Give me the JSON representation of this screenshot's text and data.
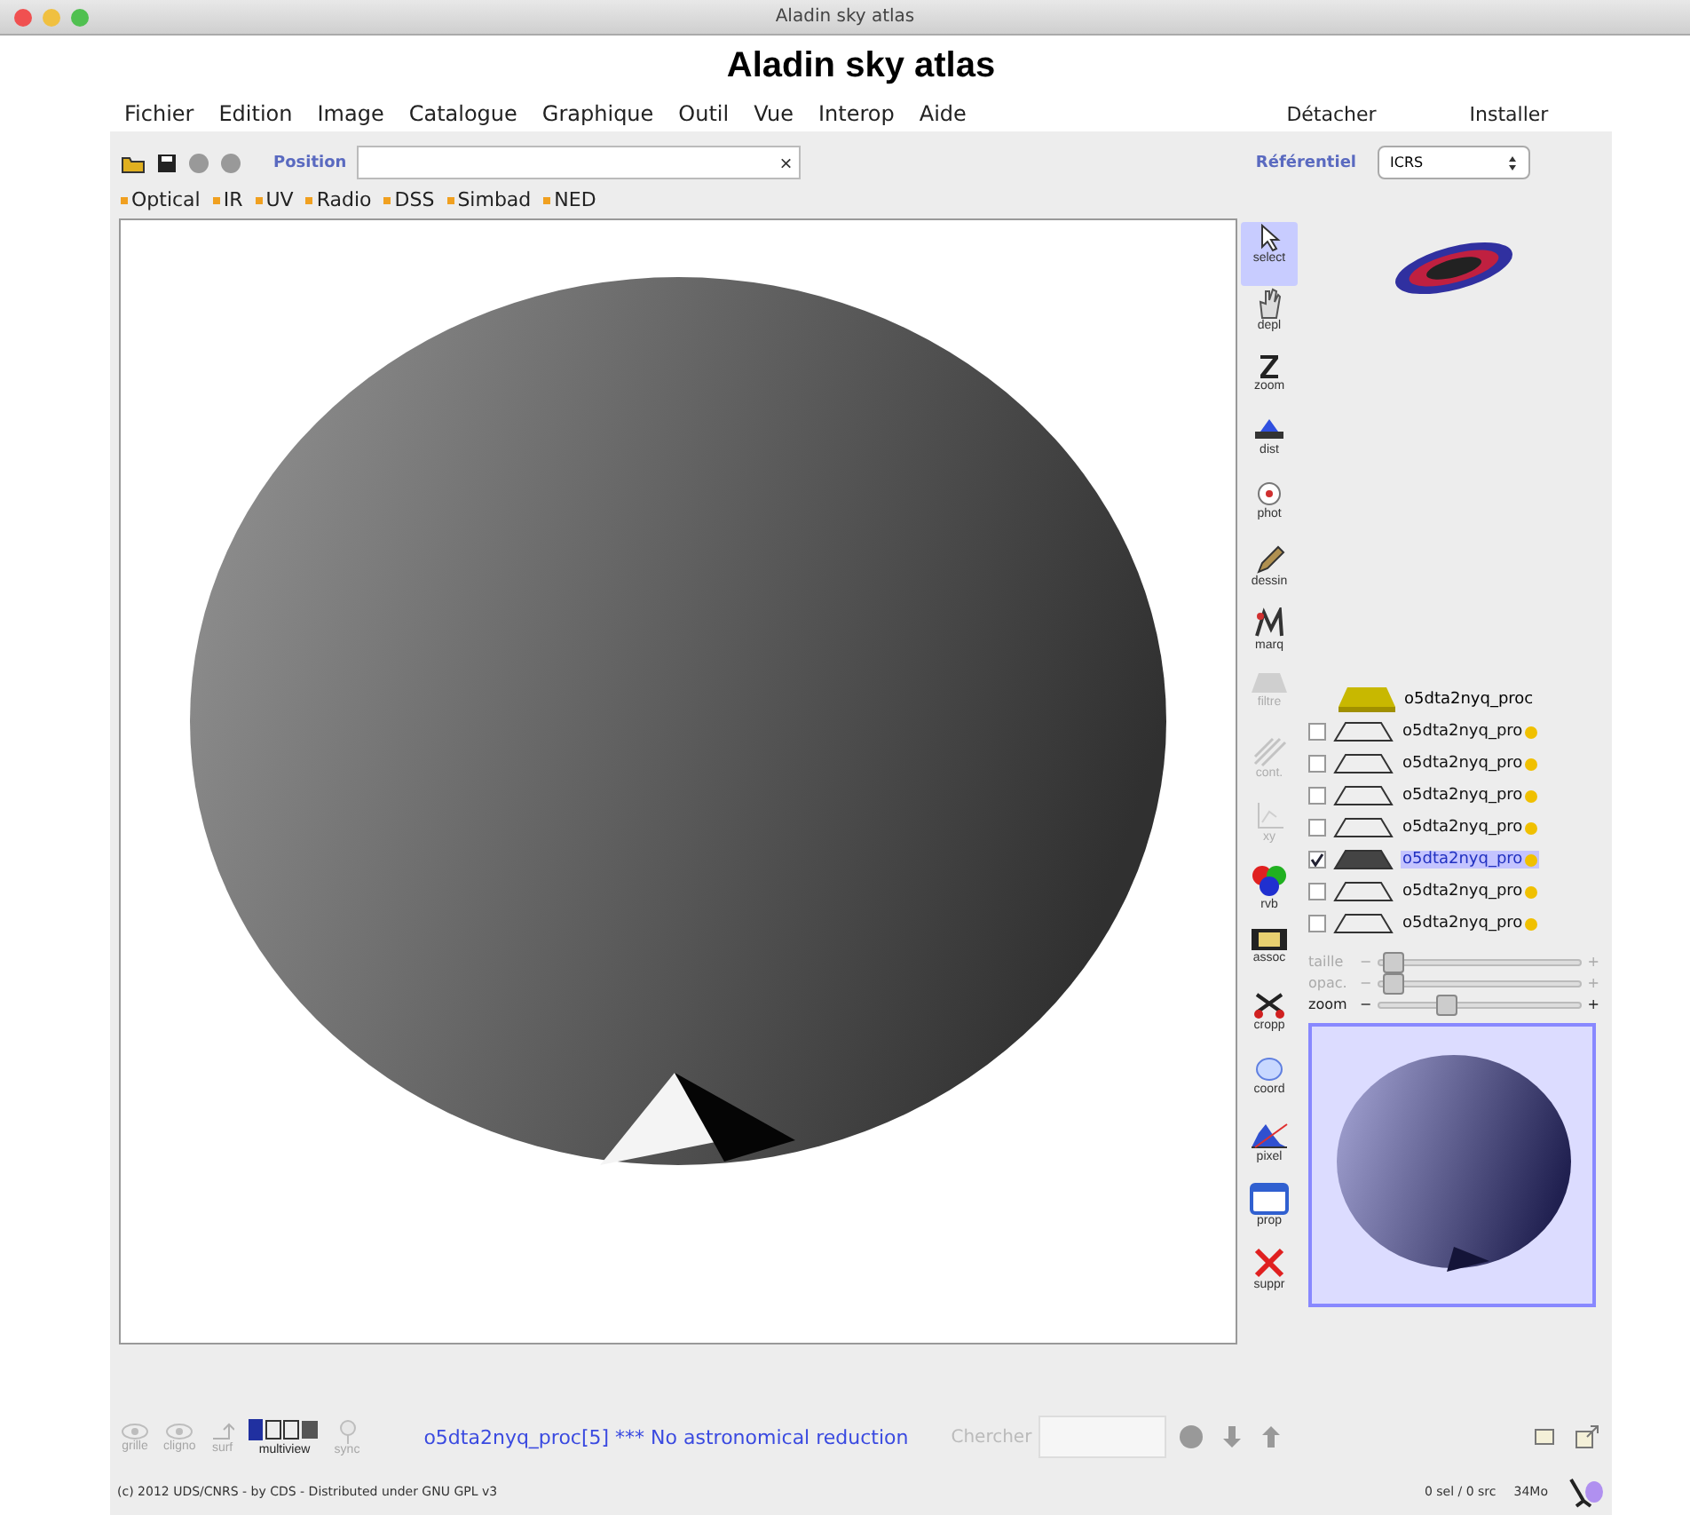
{
  "window": {
    "title": "Aladin sky atlas"
  },
  "app_title": "Aladin sky atlas",
  "menu": [
    "Fichier",
    "Edition",
    "Image",
    "Catalogue",
    "Graphique",
    "Outil",
    "Vue",
    "Interop",
    "Aide"
  ],
  "menu_right": [
    "Détacher",
    "Installer"
  ],
  "toolbar": {
    "position_label": "Position",
    "clear": "×",
    "frame_label": "Référentiel",
    "frame_value": "ICRS"
  },
  "servers": [
    "Optical",
    "IR",
    "UV",
    "Radio",
    "DSS",
    "Simbad",
    "NED"
  ],
  "tools": [
    {
      "kind": "select",
      "label": "select",
      "selected": true,
      "disabled": false
    },
    {
      "kind": "hand",
      "label": "depl",
      "selected": false,
      "disabled": false
    },
    {
      "kind": "zoom",
      "label": "zoom",
      "selected": false,
      "disabled": false
    },
    {
      "kind": "dist",
      "label": "dist",
      "selected": false,
      "disabled": false
    },
    {
      "kind": "phot",
      "label": "phot",
      "selected": false,
      "disabled": false
    },
    {
      "kind": "pencil",
      "label": "dessin",
      "selected": false,
      "disabled": false
    },
    {
      "kind": "marq",
      "label": "marq",
      "selected": false,
      "disabled": false
    },
    {
      "kind": "filter",
      "label": "filtre",
      "selected": false,
      "disabled": true
    },
    {
      "kind": "cont",
      "label": "cont.",
      "selected": false,
      "disabled": true
    },
    {
      "kind": "plot",
      "label": "xy",
      "selected": false,
      "disabled": true
    },
    {
      "kind": "rgb",
      "label": "rvb",
      "selected": false,
      "disabled": false
    },
    {
      "kind": "film",
      "label": "assoc",
      "selected": false,
      "disabled": false
    },
    {
      "kind": "scissors",
      "label": "cropp",
      "selected": false,
      "disabled": false
    },
    {
      "kind": "globe",
      "label": "coord",
      "selected": false,
      "disabled": false
    },
    {
      "kind": "hist",
      "label": "pixel",
      "selected": false,
      "disabled": false
    },
    {
      "kind": "window",
      "label": "prop",
      "selected": false,
      "disabled": false
    },
    {
      "kind": "delete",
      "label": "suppr",
      "selected": false,
      "disabled": false
    }
  ],
  "stack": {
    "folder": "o5dta2nyq_proc",
    "planes": [
      {
        "name": "o5dta2nyq_pro",
        "checked": false,
        "selected": false
      },
      {
        "name": "o5dta2nyq_pro",
        "checked": false,
        "selected": false
      },
      {
        "name": "o5dta2nyq_pro",
        "checked": false,
        "selected": false
      },
      {
        "name": "o5dta2nyq_pro",
        "checked": false,
        "selected": false
      },
      {
        "name": "o5dta2nyq_pro",
        "checked": true,
        "selected": true
      },
      {
        "name": "o5dta2nyq_pro",
        "checked": false,
        "selected": false
      },
      {
        "name": "o5dta2nyq_pro",
        "checked": false,
        "selected": false
      }
    ]
  },
  "sliders": [
    {
      "label": "taille",
      "minus": "−",
      "plus": "+",
      "level": 0.04,
      "disabled": true
    },
    {
      "label": "opac.",
      "minus": "−",
      "plus": "+",
      "level": 0.04,
      "disabled": true
    },
    {
      "label": "zoom",
      "minus": "−",
      "plus": "+",
      "level": 0.3,
      "disabled": false
    }
  ],
  "bottom_tools": [
    {
      "kind": "eye",
      "label": "grille",
      "disabled": true
    },
    {
      "kind": "eye",
      "label": "cligno",
      "disabled": true
    },
    {
      "kind": "arrow",
      "label": "surf",
      "disabled": true
    },
    {
      "kind": "grid",
      "label": "multiview",
      "disabled": false
    },
    {
      "kind": "pin",
      "label": "sync",
      "disabled": true
    }
  ],
  "status_message": "o5dta2nyq_proc[5] *** No astronomical reduction",
  "search_label": "Chercher",
  "footer": {
    "copyright": "(c) 2012 UDS/CNRS - by CDS - Distributed under GNU GPL v3",
    "selection": "0 sel / 0 src",
    "memory": "34Mo"
  }
}
